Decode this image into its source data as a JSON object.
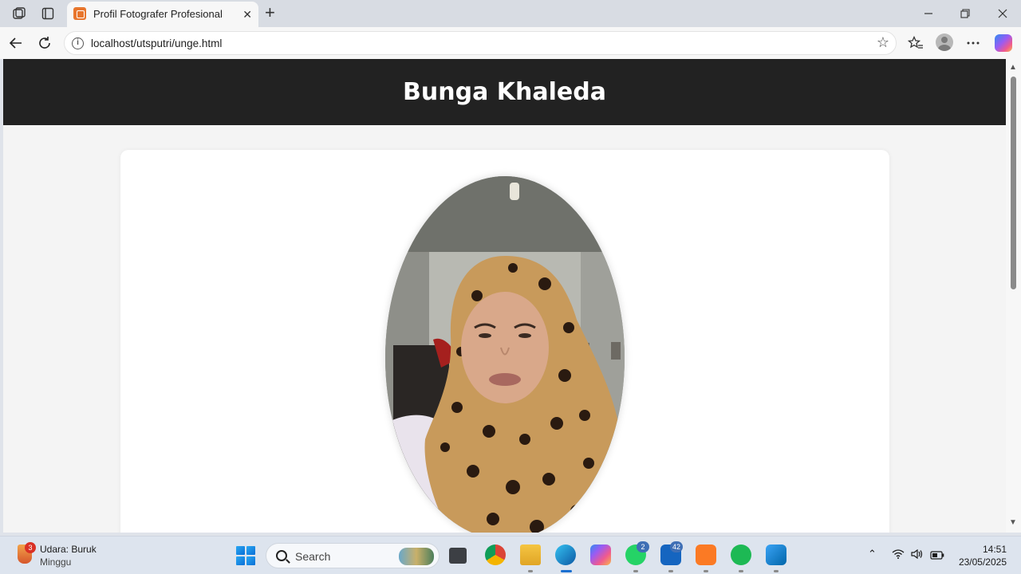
{
  "browser": {
    "tab_title": "Profil Fotografer Profesional",
    "tab_close": "✕",
    "new_tab": "+",
    "address": "localhost/utsputri/unge.html"
  },
  "page": {
    "header_title": "Bunga Khaleda",
    "header_bg": "#222222",
    "body_bg": "#f4f4f4",
    "photo_alt": "Foto profil"
  },
  "taskbar": {
    "weather_badge": "3",
    "weather_line1": "Udara: Buruk",
    "weather_line2": "Minggu",
    "search_placeholder": "Search",
    "whatsapp_badge": "2",
    "store_badge": "42",
    "time": "14:51",
    "date": "23/05/2025"
  },
  "icons": [
    "workspaces-icon",
    "tab-actions-icon",
    "back-icon",
    "refresh-icon",
    "info-icon",
    "star-icon",
    "favorites-icon",
    "profile-icon",
    "more-icon",
    "copilot-icon",
    "minimize-icon",
    "restore-icon",
    "close-icon"
  ]
}
